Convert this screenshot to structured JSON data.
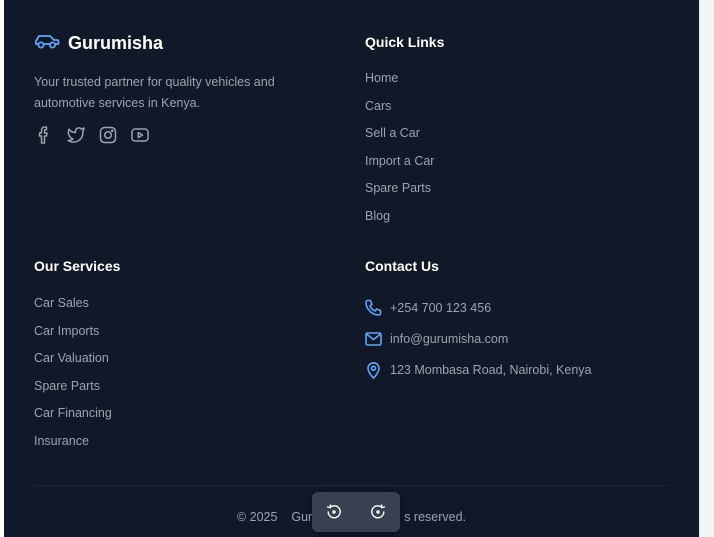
{
  "brand": {
    "name": "Gurumisha",
    "tagline": "Your trusted partner for quality vehicles and automotive services in Kenya.",
    "icon": "car-icon",
    "accent": "#60a5fa"
  },
  "socials": [
    {
      "icon": "facebook-icon"
    },
    {
      "icon": "twitter-icon"
    },
    {
      "icon": "instagram-icon"
    },
    {
      "icon": "youtube-icon"
    }
  ],
  "quick_links": {
    "title": "Quick Links",
    "items": [
      "Home",
      "Cars",
      "Sell a Car",
      "Import a Car",
      "Spare Parts",
      "Blog"
    ]
  },
  "services": {
    "title": "Our Services",
    "items": [
      "Car Sales",
      "Car Imports",
      "Car Valuation",
      "Spare Parts",
      "Car Financing",
      "Insurance"
    ]
  },
  "contact": {
    "title": "Contact Us",
    "phone": "+254 700 123 456",
    "email": "info@gurumisha.com",
    "address": "123 Mombasa Road, Nairobi, Kenya"
  },
  "copyright": {
    "left": "© 2025",
    "mid": "Gur",
    "right": "s reserved."
  },
  "toolbar": {
    "rotate_left_icon": "rotate-left-icon",
    "rotate_right_icon": "rotate-right-icon"
  },
  "colors": {
    "background": "#111827",
    "text": "#9ca3af",
    "heading": "#ffffff"
  }
}
